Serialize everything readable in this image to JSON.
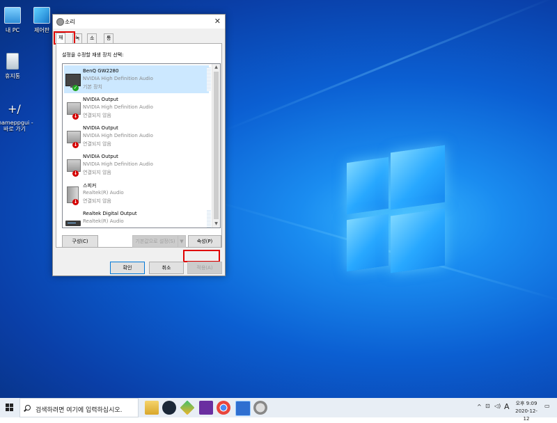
{
  "desktop": {
    "icons": [
      {
        "label": "내 PC",
        "icon": "this-pc-icon"
      },
      {
        "label": "제어판",
        "icon": "control-panel-icon"
      },
      {
        "label": "휴지통",
        "icon": "recycle-bin-icon"
      },
      {
        "label": "mameppgui - 바로 가기",
        "icon": "shortcut-icon"
      }
    ]
  },
  "window": {
    "title": "소리",
    "tabs": [
      {
        "label": "재생"
      },
      {
        "label": "녹음"
      },
      {
        "label": "소리"
      },
      {
        "label": "통신"
      }
    ],
    "instruction": "설정을 수정할 재생 장치 선택:",
    "devices": [
      {
        "name": "BenQ GW2280",
        "driver": "NVIDIA High Definition Audio",
        "status": "기본 장치",
        "icon": "monitor-icon"
      },
      {
        "name": "NVIDIA Output",
        "driver": "NVIDIA High Definition Audio",
        "status": "연결되지 않음",
        "icon": "speaker-icon"
      },
      {
        "name": "NVIDIA Output",
        "driver": "NVIDIA High Definition Audio",
        "status": "연결되지 않음",
        "icon": "speaker-icon"
      },
      {
        "name": "NVIDIA Output",
        "driver": "NVIDIA High Definition Audio",
        "status": "연결되지 않음",
        "icon": "speaker-icon"
      },
      {
        "name": "스피커",
        "driver": "Realtek(R) Audio",
        "status": "연결되지 않음",
        "icon": "speaker-icon"
      },
      {
        "name": "Realtek Digital Output",
        "driver": "Realtek(R) Audio",
        "status": "",
        "icon": "digital-output-icon"
      }
    ],
    "buttons": {
      "configure": "구성(C)",
      "set_default": "기본값으로 설정(S)",
      "set_default_arrow": "▼",
      "properties": "속성(P)",
      "ok": "확인",
      "cancel": "취소",
      "apply": "적용(A)"
    }
  },
  "taskbar": {
    "search_placeholder": "검색하려면 여기에 입력하십시오.",
    "apps": [
      "file-explorer-icon",
      "steam-icon",
      "app-icon",
      "media-app-icon",
      "chrome-icon",
      "sound-settings-icon",
      "sound-icon"
    ],
    "tray": {
      "ime": "A",
      "time": "오후 9:09",
      "date": "2020-12-12"
    }
  },
  "colors": {
    "highlight": "#e00000",
    "selection": "#cce8ff",
    "accent": "#0078d7"
  }
}
